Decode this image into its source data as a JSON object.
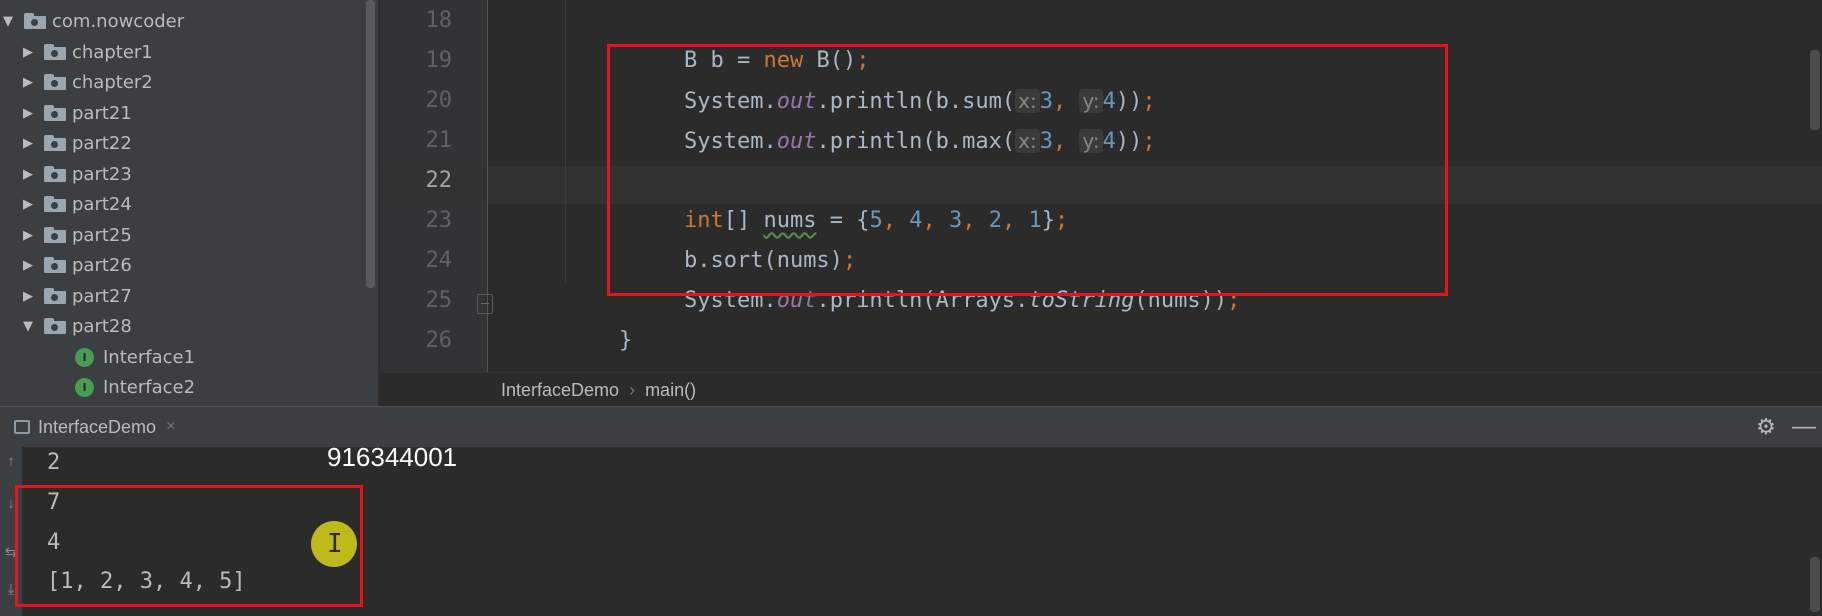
{
  "project_tree": {
    "items": [
      {
        "label": "com.nowcoder",
        "type": "package",
        "expanded": true
      },
      {
        "label": "chapter1",
        "type": "package",
        "expanded": false
      },
      {
        "label": "chapter2",
        "type": "package",
        "expanded": false
      },
      {
        "label": "part21",
        "type": "package",
        "expanded": false
      },
      {
        "label": "part22",
        "type": "package",
        "expanded": false
      },
      {
        "label": "part23",
        "type": "package",
        "expanded": false
      },
      {
        "label": "part24",
        "type": "package",
        "expanded": false
      },
      {
        "label": "part25",
        "type": "package",
        "expanded": false
      },
      {
        "label": "part26",
        "type": "package",
        "expanded": false
      },
      {
        "label": "part27",
        "type": "package",
        "expanded": false
      },
      {
        "label": "part28",
        "type": "package",
        "expanded": true
      },
      {
        "label": "Interface1",
        "type": "interface"
      },
      {
        "label": "Interface2",
        "type": "interface"
      }
    ],
    "interface_icon_letter": "I"
  },
  "editor": {
    "line_numbers": [
      "18",
      "19",
      "20",
      "21",
      "22",
      "23",
      "24",
      "25",
      "26"
    ],
    "current_line": "22",
    "code": {
      "l18": {
        "t1": "B b = ",
        "kw": "new",
        "t2": " B()",
        "semi": ";"
      },
      "l19": {
        "t1": "System.",
        "field": "out",
        "t2": ".println(b.sum(",
        "hint_x": "x:",
        "v1": "3",
        "comma": ", ",
        "hint_y": "y:",
        "v2": "4",
        "t3": "))",
        "semi": ";"
      },
      "l20": {
        "t1": "System.",
        "field": "out",
        "t2": ".println(b.max(",
        "hint_x": "x:",
        "v1": "3",
        "comma": ", ",
        "hint_y": "y:",
        "v2": "4",
        "t3": "))",
        "semi": ";"
      },
      "l22": {
        "kw": "int",
        "t1": "[] ",
        "var": "nums",
        "t2": " = {",
        "n1": "5",
        "n2": "4",
        "n3": "3",
        "n4": "2",
        "n5": "1",
        "sep": ", ",
        "t3": "}",
        "semi": ";"
      },
      "l23": {
        "t1": "b.sort(nums)",
        "semi": ";"
      },
      "l24": {
        "t1": "System.",
        "field": "out",
        "t2": ".println(Arrays.",
        "method": "toString",
        "t3": "(nums))",
        "semi": ";"
      },
      "l25": {
        "t1": "}"
      }
    }
  },
  "breadcrumb": {
    "items": [
      "InterfaceDemo",
      "main()"
    ],
    "separator": "›"
  },
  "run_window": {
    "tab_label": "InterfaceDemo",
    "tab_close": "×",
    "gear": "⚙",
    "minimize": "—",
    "output": [
      "2",
      "7",
      "4",
      "[1, 2, 3, 4, 5]"
    ]
  },
  "overlay": {
    "watermark": "916344001",
    "cursor_glyph": "I"
  },
  "colors": {
    "annotation_red": "#e8141d",
    "cursor_yellow": "#cdc619",
    "keyword": "#cc7832",
    "number": "#6897bb",
    "field": "#9876aa"
  },
  "icons": {
    "collapsed_arrow": "▶",
    "expanded_arrow": "▼"
  }
}
